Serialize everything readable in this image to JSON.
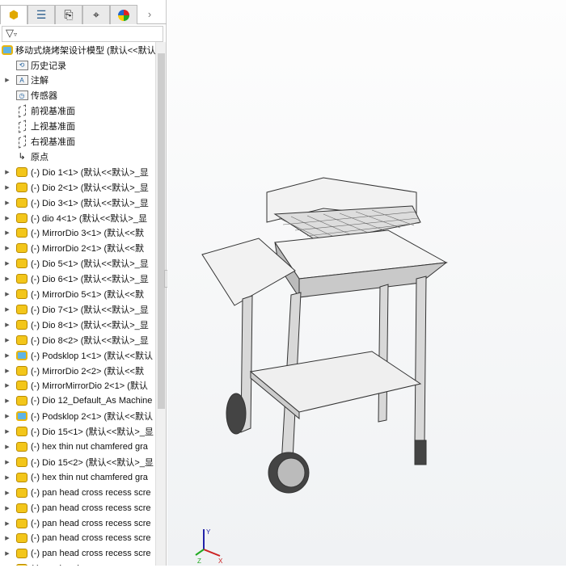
{
  "tabs": [
    {
      "name": "feature-manager",
      "icon": "assembly-icon"
    },
    {
      "name": "property-manager",
      "icon": "list-icon"
    },
    {
      "name": "configuration-manager",
      "icon": "config-icon"
    },
    {
      "name": "dimxpert",
      "icon": "crosshair-icon"
    },
    {
      "name": "display-manager",
      "icon": "color-wheel-icon"
    }
  ],
  "filter": {
    "icon": "▿"
  },
  "tree": {
    "root": "移动式烧烤架设计模型  (默认<<默认",
    "items": [
      {
        "label": "历史记录",
        "icon": "history-folder",
        "arrow": false
      },
      {
        "label": "注解",
        "icon": "annotation-folder",
        "arrow": true
      },
      {
        "label": "传感器",
        "icon": "sensor-folder",
        "arrow": false
      },
      {
        "label": "前视基准面",
        "icon": "plane",
        "arrow": false
      },
      {
        "label": "上视基准面",
        "icon": "plane",
        "arrow": false
      },
      {
        "label": "右视基准面",
        "icon": "plane",
        "arrow": false
      },
      {
        "label": "原点",
        "icon": "origin",
        "arrow": false
      },
      {
        "label": "(-) Dio 1<1> (默认<<默认>_显",
        "icon": "part",
        "arrow": true
      },
      {
        "label": "(-) Dio 2<1> (默认<<默认>_显",
        "icon": "part",
        "arrow": true
      },
      {
        "label": "(-) Dio 3<1> (默认<<默认>_显",
        "icon": "part",
        "arrow": true
      },
      {
        "label": "(-) dio 4<1> (默认<<默认>_显",
        "icon": "part",
        "arrow": true
      },
      {
        "label": "(-) MirrorDio 3<1> (默认<<默",
        "icon": "part",
        "arrow": true
      },
      {
        "label": "(-) MirrorDio 2<1> (默认<<默",
        "icon": "part",
        "arrow": true
      },
      {
        "label": "(-) Dio 5<1> (默认<<默认>_显",
        "icon": "part",
        "arrow": true
      },
      {
        "label": "(-) Dio 6<1> (默认<<默认>_显",
        "icon": "part",
        "arrow": true
      },
      {
        "label": "(-) MirrorDio 5<1> (默认<<默",
        "icon": "part",
        "arrow": true
      },
      {
        "label": "(-) Dio 7<1> (默认<<默认>_显",
        "icon": "part",
        "arrow": true
      },
      {
        "label": "(-) Dio 8<1> (默认<<默认>_显",
        "icon": "part",
        "arrow": true
      },
      {
        "label": "(-) Dio 8<2> (默认<<默认>_显",
        "icon": "part",
        "arrow": true
      },
      {
        "label": "(-) Podsklop 1<1> (默认<<默认",
        "icon": "assembly",
        "arrow": true
      },
      {
        "label": "(-) MirrorDio 2<2> (默认<<默",
        "icon": "part",
        "arrow": true
      },
      {
        "label": "(-) MirrorMirrorDio 2<1> (默认",
        "icon": "part",
        "arrow": true
      },
      {
        "label": "(-) Dio 12_Default_As Machine",
        "icon": "part",
        "arrow": true
      },
      {
        "label": "(-) Podsklop 2<1> (默认<<默认",
        "icon": "assembly",
        "arrow": true
      },
      {
        "label": "(-) Dio 15<1> (默认<<默认>_显",
        "icon": "part",
        "arrow": true
      },
      {
        "label": "(-) hex thin nut chamfered gra",
        "icon": "part",
        "arrow": true
      },
      {
        "label": "(-) Dio 15<2> (默认<<默认>_显",
        "icon": "part",
        "arrow": true
      },
      {
        "label": "(-) hex thin nut chamfered gra",
        "icon": "part",
        "arrow": true
      },
      {
        "label": "(-) pan head cross recess scre",
        "icon": "part",
        "arrow": true
      },
      {
        "label": "(-) pan head cross recess scre",
        "icon": "part",
        "arrow": true
      },
      {
        "label": "(-) pan head cross recess scre",
        "icon": "part",
        "arrow": true
      },
      {
        "label": "(-) pan head cross recess scre",
        "icon": "part",
        "arrow": true
      },
      {
        "label": "(-) pan head cross recess scre",
        "icon": "part",
        "arrow": true
      },
      {
        "label": "(-) pan head cross recess scre",
        "icon": "part",
        "arrow": true
      }
    ]
  },
  "triad": {
    "x": "X",
    "y": "Y",
    "z": "Z"
  }
}
